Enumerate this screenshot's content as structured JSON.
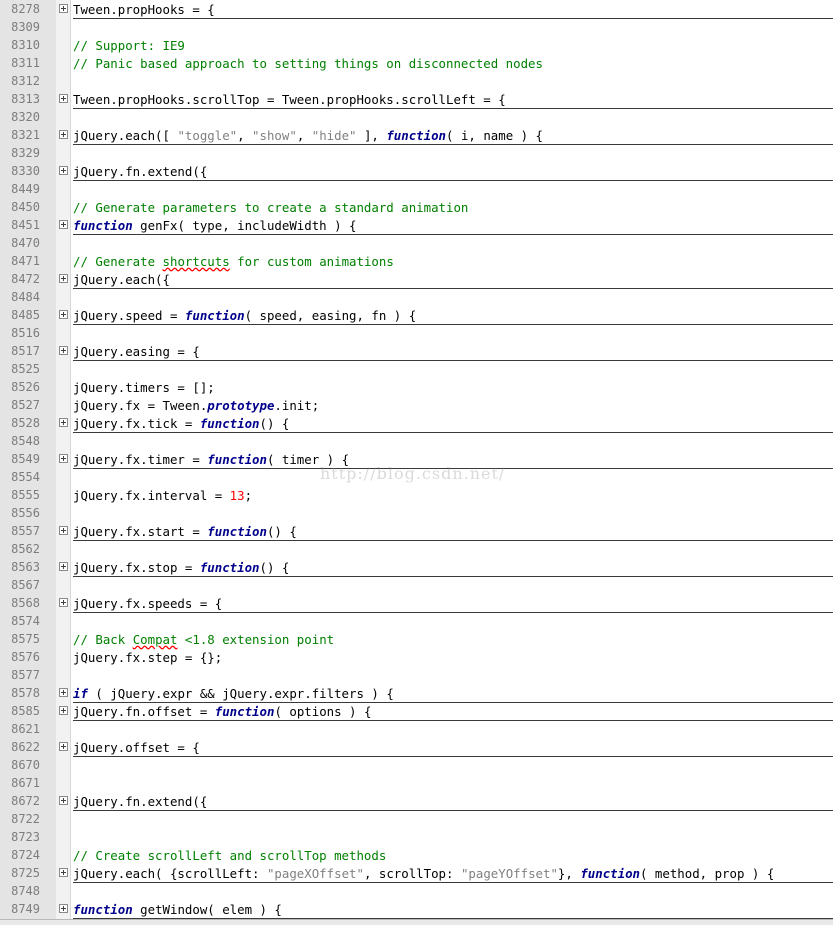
{
  "watermark": "http://blog.csdn.net/",
  "lines": [
    {
      "num": "8278",
      "fold": true,
      "tokens": [
        [
          "plain",
          "Tween.propHooks = {"
        ]
      ]
    },
    {
      "num": "8309",
      "fold": false,
      "tokens": []
    },
    {
      "num": "8310",
      "fold": false,
      "tokens": [
        [
          "cmt",
          "// Support: IE9"
        ]
      ]
    },
    {
      "num": "8311",
      "fold": false,
      "tokens": [
        [
          "cmt",
          "// Panic based approach to setting things on disconnected nodes"
        ]
      ]
    },
    {
      "num": "8312",
      "fold": false,
      "tokens": []
    },
    {
      "num": "8313",
      "fold": true,
      "tokens": [
        [
          "plain",
          "Tween.propHooks.scrollTop = Tween.propHooks.scrollLeft = {"
        ]
      ]
    },
    {
      "num": "8320",
      "fold": false,
      "tokens": []
    },
    {
      "num": "8321",
      "fold": true,
      "tokens": [
        [
          "plain",
          "jQuery.each([ "
        ],
        [
          "str",
          "\"toggle\""
        ],
        [
          "plain",
          ", "
        ],
        [
          "str",
          "\"show\""
        ],
        [
          "plain",
          ", "
        ],
        [
          "str",
          "\"hide\""
        ],
        [
          "plain",
          " ], "
        ],
        [
          "kw",
          "function"
        ],
        [
          "plain",
          "( i, name ) {"
        ]
      ]
    },
    {
      "num": "8329",
      "fold": false,
      "tokens": []
    },
    {
      "num": "8330",
      "fold": true,
      "tokens": [
        [
          "plain",
          "jQuery.fn.extend({"
        ]
      ]
    },
    {
      "num": "8449",
      "fold": false,
      "tokens": []
    },
    {
      "num": "8450",
      "fold": false,
      "tokens": [
        [
          "cmt",
          "// Generate parameters to create a standard animation"
        ]
      ]
    },
    {
      "num": "8451",
      "fold": true,
      "tokens": [
        [
          "kw",
          "function"
        ],
        [
          "plain",
          " genFx( type, includeWidth ) {"
        ]
      ]
    },
    {
      "num": "8470",
      "fold": false,
      "tokens": []
    },
    {
      "num": "8471",
      "fold": false,
      "tokens": [
        [
          "cmt",
          "// Generate "
        ],
        [
          "spell",
          "shortcuts"
        ],
        [
          "cmt",
          " for custom animations"
        ]
      ]
    },
    {
      "num": "8472",
      "fold": true,
      "tokens": [
        [
          "plain",
          "jQuery.each({"
        ]
      ]
    },
    {
      "num": "8484",
      "fold": false,
      "tokens": []
    },
    {
      "num": "8485",
      "fold": true,
      "tokens": [
        [
          "plain",
          "jQuery.speed = "
        ],
        [
          "kw",
          "function"
        ],
        [
          "plain",
          "( speed, easing, fn ) {"
        ]
      ]
    },
    {
      "num": "8516",
      "fold": false,
      "tokens": []
    },
    {
      "num": "8517",
      "fold": true,
      "tokens": [
        [
          "plain",
          "jQuery.easing = {"
        ]
      ]
    },
    {
      "num": "8525",
      "fold": false,
      "tokens": []
    },
    {
      "num": "8526",
      "fold": false,
      "tokens": [
        [
          "plain",
          "jQuery.timers = [];"
        ]
      ]
    },
    {
      "num": "8527",
      "fold": false,
      "tokens": [
        [
          "plain",
          "jQuery.fx = Tween."
        ],
        [
          "prop",
          "prototype"
        ],
        [
          "plain",
          ".init;"
        ]
      ]
    },
    {
      "num": "8528",
      "fold": true,
      "tokens": [
        [
          "plain",
          "jQuery.fx.tick = "
        ],
        [
          "kw",
          "function"
        ],
        [
          "plain",
          "() {"
        ]
      ]
    },
    {
      "num": "8548",
      "fold": false,
      "tokens": []
    },
    {
      "num": "8549",
      "fold": true,
      "tokens": [
        [
          "plain",
          "jQuery.fx.timer = "
        ],
        [
          "kw",
          "function"
        ],
        [
          "plain",
          "( timer ) {"
        ]
      ]
    },
    {
      "num": "8554",
      "fold": false,
      "tokens": []
    },
    {
      "num": "8555",
      "fold": false,
      "tokens": [
        [
          "plain",
          "jQuery.fx.interval = "
        ],
        [
          "num",
          "13"
        ],
        [
          "plain",
          ";"
        ]
      ]
    },
    {
      "num": "8556",
      "fold": false,
      "tokens": []
    },
    {
      "num": "8557",
      "fold": true,
      "tokens": [
        [
          "plain",
          "jQuery.fx.start = "
        ],
        [
          "kw",
          "function"
        ],
        [
          "plain",
          "() {"
        ]
      ]
    },
    {
      "num": "8562",
      "fold": false,
      "tokens": []
    },
    {
      "num": "8563",
      "fold": true,
      "tokens": [
        [
          "plain",
          "jQuery.fx.stop = "
        ],
        [
          "kw",
          "function"
        ],
        [
          "plain",
          "() {"
        ]
      ]
    },
    {
      "num": "8567",
      "fold": false,
      "tokens": []
    },
    {
      "num": "8568",
      "fold": true,
      "tokens": [
        [
          "plain",
          "jQuery.fx.speeds = {"
        ]
      ]
    },
    {
      "num": "8574",
      "fold": false,
      "tokens": []
    },
    {
      "num": "8575",
      "fold": false,
      "tokens": [
        [
          "cmt",
          "// Back "
        ],
        [
          "spell",
          "Compat"
        ],
        [
          "cmt",
          " <1.8 extension point"
        ]
      ]
    },
    {
      "num": "8576",
      "fold": false,
      "tokens": [
        [
          "plain",
          "jQuery.fx.step = {};"
        ]
      ]
    },
    {
      "num": "8577",
      "fold": false,
      "tokens": []
    },
    {
      "num": "8578",
      "fold": true,
      "tokens": [
        [
          "kw",
          "if"
        ],
        [
          "plain",
          " ( jQuery.expr && jQuery.expr.filters ) {"
        ]
      ]
    },
    {
      "num": "8585",
      "fold": true,
      "tokens": [
        [
          "plain",
          "jQuery.fn.offset = "
        ],
        [
          "kw",
          "function"
        ],
        [
          "plain",
          "( options ) {"
        ]
      ]
    },
    {
      "num": "8621",
      "fold": false,
      "tokens": []
    },
    {
      "num": "8622",
      "fold": true,
      "tokens": [
        [
          "plain",
          "jQuery.offset = {"
        ]
      ]
    },
    {
      "num": "8670",
      "fold": false,
      "tokens": []
    },
    {
      "num": "8671",
      "fold": false,
      "tokens": []
    },
    {
      "num": "8672",
      "fold": true,
      "tokens": [
        [
          "plain",
          "jQuery.fn.extend({"
        ]
      ]
    },
    {
      "num": "8722",
      "fold": false,
      "tokens": []
    },
    {
      "num": "8723",
      "fold": false,
      "tokens": []
    },
    {
      "num": "8724",
      "fold": false,
      "tokens": [
        [
          "cmt",
          "// Create scrollLeft and scrollTop methods"
        ]
      ]
    },
    {
      "num": "8725",
      "fold": true,
      "tokens": [
        [
          "plain",
          "jQuery.each( {scrollLeft: "
        ],
        [
          "str",
          "\"pageXOffset\""
        ],
        [
          "plain",
          ", scrollTop: "
        ],
        [
          "str",
          "\"pageYOffset\""
        ],
        [
          "plain",
          "}, "
        ],
        [
          "kw",
          "function"
        ],
        [
          "plain",
          "( method, prop ) {"
        ]
      ]
    },
    {
      "num": "8748",
      "fold": false,
      "tokens": []
    },
    {
      "num": "8749",
      "fold": true,
      "tokens": [
        [
          "kw",
          "function"
        ],
        [
          "plain",
          " getWindow( elem ) {"
        ]
      ]
    }
  ]
}
